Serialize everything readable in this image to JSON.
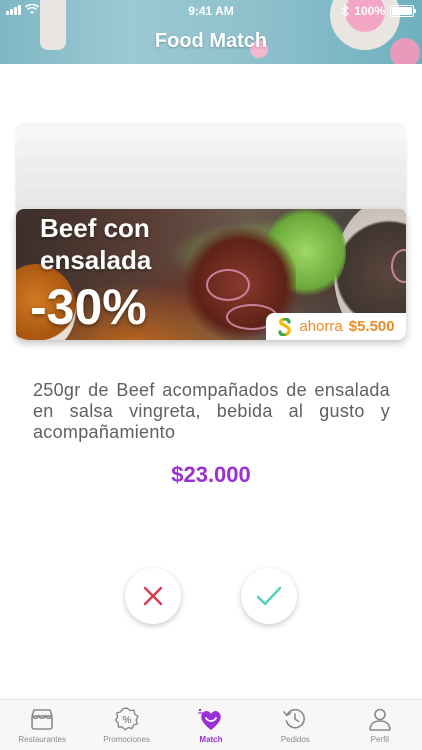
{
  "status_bar": {
    "time": "9:41 AM",
    "battery": "100%"
  },
  "header": {
    "title": "Food Match"
  },
  "promo_card": {
    "line1": "Beef con",
    "line2": "ensalada",
    "discount": "-30%",
    "save_label": "ahorra",
    "save_amount": "$5.500"
  },
  "product": {
    "description": "250gr de Beef acompañados de ensalada en salsa vingreta, bebida al gusto y acompañamiento",
    "price": "$23.000"
  },
  "actions": {
    "reject_icon": "x-icon",
    "accept_icon": "check-icon"
  },
  "tabbar": {
    "items": [
      {
        "label": "Restaurantes",
        "icon": "store-icon"
      },
      {
        "label": "Promociones",
        "icon": "percent-badge-icon"
      },
      {
        "label": "Match",
        "icon": "match-heart-icon"
      },
      {
        "label": "Pedidos",
        "icon": "history-icon"
      },
      {
        "label": "Perfil",
        "icon": "user-icon"
      }
    ],
    "active_index": 2
  },
  "colors": {
    "accent": "#9b2fd6",
    "reject": "#d93a4b",
    "accept": "#4fd3b8",
    "save_badge": "#f08a25"
  }
}
